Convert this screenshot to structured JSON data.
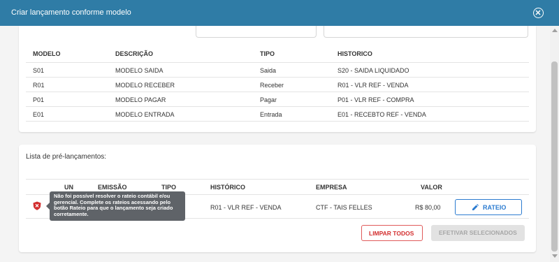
{
  "dialog": {
    "title": "Criar lançamento conforme modelo"
  },
  "models": {
    "columns": [
      "MODELO",
      "DESCRIÇÃO",
      "TIPO",
      "HISTORICO"
    ],
    "rows": [
      [
        "S01",
        "MODELO SAIDA",
        "Saida",
        "S20 - SAIDA LIQUIDADO"
      ],
      [
        "R01",
        "MODELO RECEBER",
        "Receber",
        "R01 - VLR REF - VENDA"
      ],
      [
        "P01",
        "MODELO PAGAR",
        "Pagar",
        "P01 - VLR REF - COMPRA"
      ],
      [
        "E01",
        "MODELO ENTRADA",
        "Entrada",
        "E01 - RECEBTO REF - VENDA"
      ]
    ]
  },
  "pre_launches": {
    "title": "Lista de pré-lançamentos:",
    "columns": [
      "UN",
      "EMISSÃO",
      "TIPO",
      "HISTÓRICO",
      "EMPRESA",
      "VALOR"
    ],
    "rows": [
      {
        "historico": "R01 - VLR REF - VENDA",
        "empresa": "CTF - TAIS FELLES",
        "valor": "R$ 80,00",
        "action": "RATEIO"
      }
    ],
    "tooltip": "Não foi possível resolver o rateio contábil e/ou gerencial. Complete os rateios acessando pelo botão Rateio para que o lançamento seja criado corretamente."
  },
  "actions": {
    "clear": "LIMPAR TODOS",
    "submit": "EFETIVAR SELECIONADOS"
  },
  "colors": {
    "header": "#2f7ca6",
    "primary": "#2b7bd0",
    "danger": "#d32f2f",
    "tooltip": "#5f6368"
  },
  "icons": {
    "close": "close-circle-icon",
    "error": "shield-error-icon",
    "edit": "pencil-icon"
  }
}
